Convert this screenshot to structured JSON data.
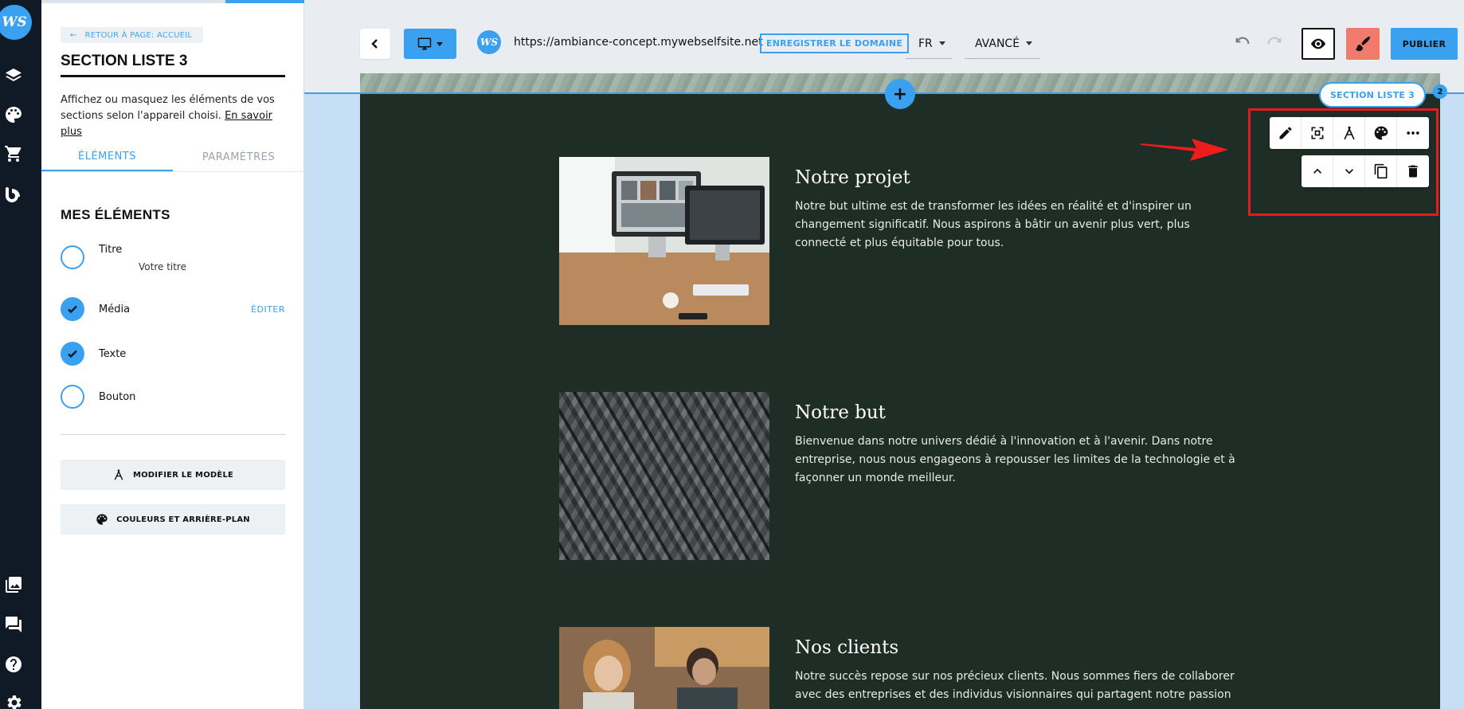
{
  "sidebar_panel": {
    "back_link": "RETOUR À PAGE: ACCUEIL",
    "title": "SECTION LISTE 3",
    "description": "Affichez ou masquez les éléments de vos sections selon l'appareil choisi.",
    "learn_more": "En savoir plus",
    "tabs": [
      "ÉLÉMENTS",
      "PARAMÈTRES"
    ],
    "elements_heading": "MES ÉLÉMENTS",
    "elements": [
      {
        "label": "Titre",
        "sublabel": "Votre titre",
        "checked": false
      },
      {
        "label": "Média",
        "action": "ÉDITER",
        "checked": true
      },
      {
        "label": "Texte",
        "checked": true
      },
      {
        "label": "Bouton",
        "checked": false
      }
    ],
    "buttons": [
      "MODIFIER LE MODÈLE",
      "COULEURS ET ARRIÈRE-PLAN"
    ]
  },
  "rail": {
    "logo": "WS",
    "icons": [
      "layers-icon",
      "palette-icon",
      "cart-icon",
      "blog-icon",
      "gallery-icon",
      "chat-icon",
      "help-icon",
      "settings-icon"
    ]
  },
  "toolbar": {
    "url": "https://ambiance-concept.mywebselfsite.net",
    "register_domain": "ENREGISTRER LE DOMAINE",
    "language": "FR",
    "mode": "AVANCÉ",
    "publish": "PUBLIER",
    "site_logo": "WS"
  },
  "canvas": {
    "section_label": "SECTION LISTE 3",
    "section_number": "2",
    "items": [
      {
        "title": "Notre projet",
        "text": "Notre but ultime est de transformer les idées en réalité et d'inspirer un changement significatif. Nous aspirons à bâtir un avenir plus vert, plus connecté et plus équitable pour tous."
      },
      {
        "title": "Notre but",
        "text": "Bienvenue dans notre univers dédié à l'innovation et à l'avenir. Dans notre entreprise, nous nous engageons à repousser les limites de la technologie et à façonner un monde meilleur."
      },
      {
        "title": "Nos clients",
        "text": "Notre succès repose sur nos précieux clients. Nous sommes fiers de collaborer avec des entreprises et des individus visionnaires qui partagent notre passion"
      }
    ]
  },
  "colors": {
    "accent": "#3aa0f0",
    "section_bg": "#1e2d25",
    "highlight": "#e41c1c",
    "brush_button": "#f07b6c"
  }
}
